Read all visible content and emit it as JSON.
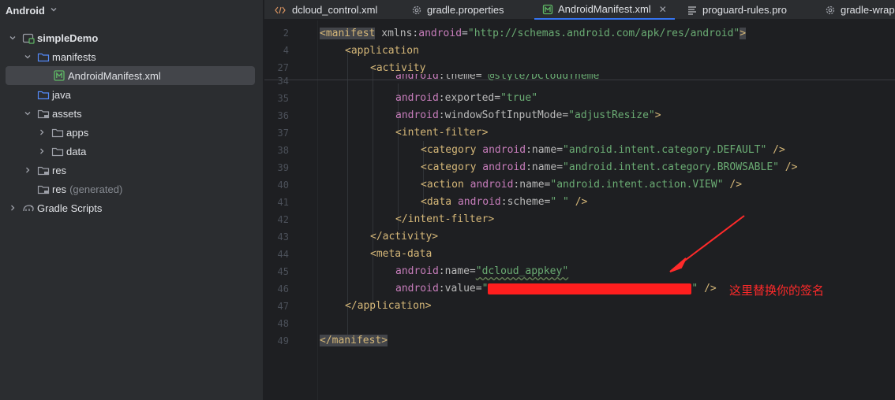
{
  "project_view": {
    "title": "Android",
    "tree": [
      {
        "label": "simpleDemo",
        "depth": 0,
        "expanded": true,
        "icon": "module-icon"
      },
      {
        "label": "manifests",
        "depth": 1,
        "expanded": true,
        "icon": "folder-icon"
      },
      {
        "label": "AndroidManifest.xml",
        "depth": 2,
        "icon": "manifest-file-icon",
        "selected": true
      },
      {
        "label": "java",
        "depth": 1,
        "icon": "folder-icon"
      },
      {
        "label": "assets",
        "depth": 1,
        "expanded": true,
        "icon": "folder-icon"
      },
      {
        "label": "apps",
        "depth": 2,
        "collapsed": true,
        "icon": "folder-icon"
      },
      {
        "label": "data",
        "depth": 2,
        "collapsed": true,
        "icon": "folder-icon"
      },
      {
        "label": "res",
        "depth": 1,
        "collapsed": true,
        "icon": "folder-icon"
      },
      {
        "label": "res",
        "suffix": "(generated)",
        "depth": 1,
        "icon": "folder-icon"
      },
      {
        "label": "Gradle Scripts",
        "depth": 0,
        "collapsed": true,
        "icon": "gradle-icon"
      }
    ]
  },
  "tabs": [
    {
      "label": "dcloud_control.xml",
      "icon": "xml-icon"
    },
    {
      "label": "gradle.properties",
      "icon": "gear-icon"
    },
    {
      "label": "AndroidManifest.xml",
      "icon": "manifest-file-icon",
      "active": true
    },
    {
      "label": "proguard-rules.pro",
      "icon": "text-file-icon"
    },
    {
      "label": "gradle-wrap",
      "icon": "gear-icon"
    }
  ],
  "editor": {
    "line_numbers": [
      "2",
      "4",
      "27",
      "34",
      "35",
      "36",
      "37",
      "38",
      "39",
      "40",
      "41",
      "42",
      "43",
      "44",
      "45",
      "46",
      "47",
      "48",
      "49"
    ],
    "lines": {
      "l2": {
        "p1": "<manifest",
        "p2": " xmlns",
        "p3": ":",
        "p4": "android",
        "p5": "=",
        "p6": "\"http://schemas.android.com/apk/res/android\"",
        "p7": ">"
      },
      "l4": {
        "p1": "<application"
      },
      "l27": {
        "p1": "<activity"
      },
      "l34": {
        "p1": "android",
        "p2": ":theme=",
        "p3": "\"@style/DCloudTheme\""
      },
      "l35": {
        "p1": "android",
        "p2": ":exported=",
        "p3": "\"true\""
      },
      "l36": {
        "p1": "android",
        "p2": ":windowSoftInputMode=",
        "p3": "\"adjustResize\"",
        "p4": ">"
      },
      "l37": {
        "p1": "<intent-filter",
        "p2": ">"
      },
      "l38": {
        "p1": "<category",
        "p2": " android",
        "p3": ":name=",
        "p4": "\"android.intent.category.DEFAULT\"",
        "p5": " />"
      },
      "l39": {
        "p1": "<category",
        "p2": " android",
        "p3": ":name=",
        "p4": "\"android.intent.category.BROWSABLE\"",
        "p5": " />"
      },
      "l40": {
        "p1": "<action",
        "p2": " android",
        "p3": ":name=",
        "p4": "\"android.intent.action.VIEW\"",
        "p5": " />"
      },
      "l41": {
        "p1": "<data",
        "p2": " android",
        "p3": ":scheme=",
        "p4": "\" \"",
        "p5": " />"
      },
      "l42": {
        "p1": "</intent-filter",
        "p2": ">"
      },
      "l43": {
        "p1": "</activity",
        "p2": ">"
      },
      "l44": {
        "p1": "<meta-data"
      },
      "l45": {
        "p1": "android",
        "p2": ":name=",
        "p3": "\"dcloud_appkey\""
      },
      "l46": {
        "p1": "android",
        "p2": ":value=",
        "p3": "\"",
        "p4": "\"",
        "p5": " />"
      },
      "l47": {
        "p1": "</application",
        "p2": ">"
      },
      "l49": {
        "p1": "</manifest",
        "p2": ">"
      }
    },
    "annotation": "这里替换你的签名",
    "annotation_color": "#ff2a2a"
  },
  "colors": {
    "tag": "#d5b778",
    "namespace": "#c77dbb",
    "string": "#6aab73",
    "active_tab_underline": "#3574f0"
  }
}
